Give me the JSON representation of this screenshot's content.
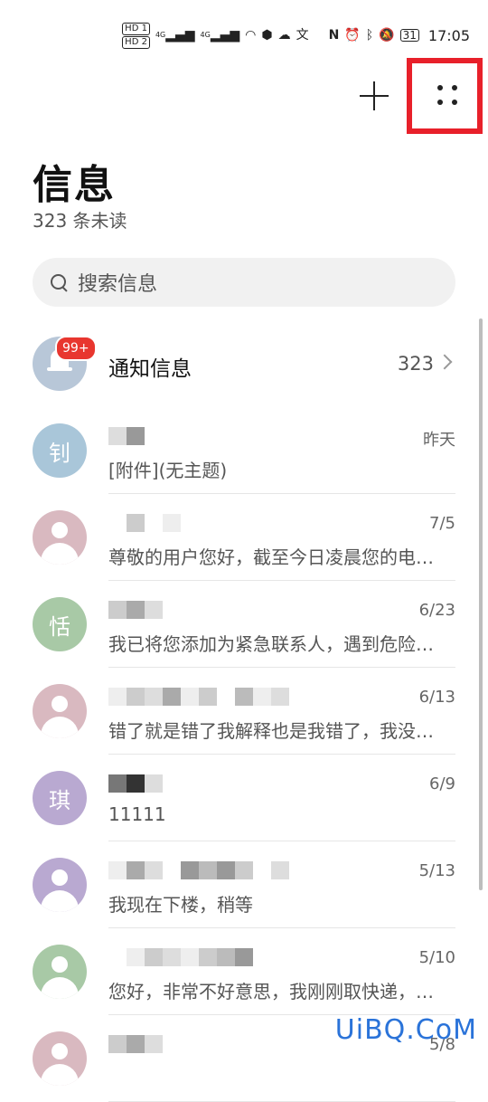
{
  "status_bar": {
    "hd1": "HD 1",
    "hd2": "HD 2",
    "net1": "4G",
    "net2": "4G",
    "lang": "文",
    "nfc": "N",
    "battery": "31",
    "time": "17:05"
  },
  "header": {
    "title": "信息",
    "unread": "323 条未读"
  },
  "search": {
    "placeholder": "搜索信息"
  },
  "notification_row": {
    "name": "通知信息",
    "badge": "99+",
    "count": "323"
  },
  "conversations": [
    {
      "avatar_char": "钊",
      "avatar_color": "#a9c6d9",
      "date": "昨天",
      "preview": "[附件](无主题)"
    },
    {
      "avatar_char": "",
      "avatar_color": "#d9b9c0",
      "date": "7/5",
      "preview": "尊敬的用户您好，截至今日凌晨您的电…"
    },
    {
      "avatar_char": "恬",
      "avatar_color": "#a8c9a6",
      "date": "6/23",
      "preview": "我已将您添加为紧急联系人，遇到危险…"
    },
    {
      "avatar_char": "",
      "avatar_color": "#d9b9c0",
      "date": "6/13",
      "preview": "错了就是错了我解释也是我错了，我没…"
    },
    {
      "avatar_char": "琪",
      "avatar_color": "#b9a9d1",
      "date": "6/9",
      "preview": "11111"
    },
    {
      "avatar_char": "",
      "avatar_color": "#b9a9d1",
      "date": "5/13",
      "preview": "我现在下楼，稍等"
    },
    {
      "avatar_char": "",
      "avatar_color": "#a8c9a6",
      "date": "5/10",
      "preview": "您好，非常不好意思，我刚刚取快递，…"
    },
    {
      "avatar_char": "",
      "avatar_color": "#d9b9c0",
      "date": "5/8",
      "preview": ""
    }
  ],
  "watermark": "UiBQ.CoM"
}
